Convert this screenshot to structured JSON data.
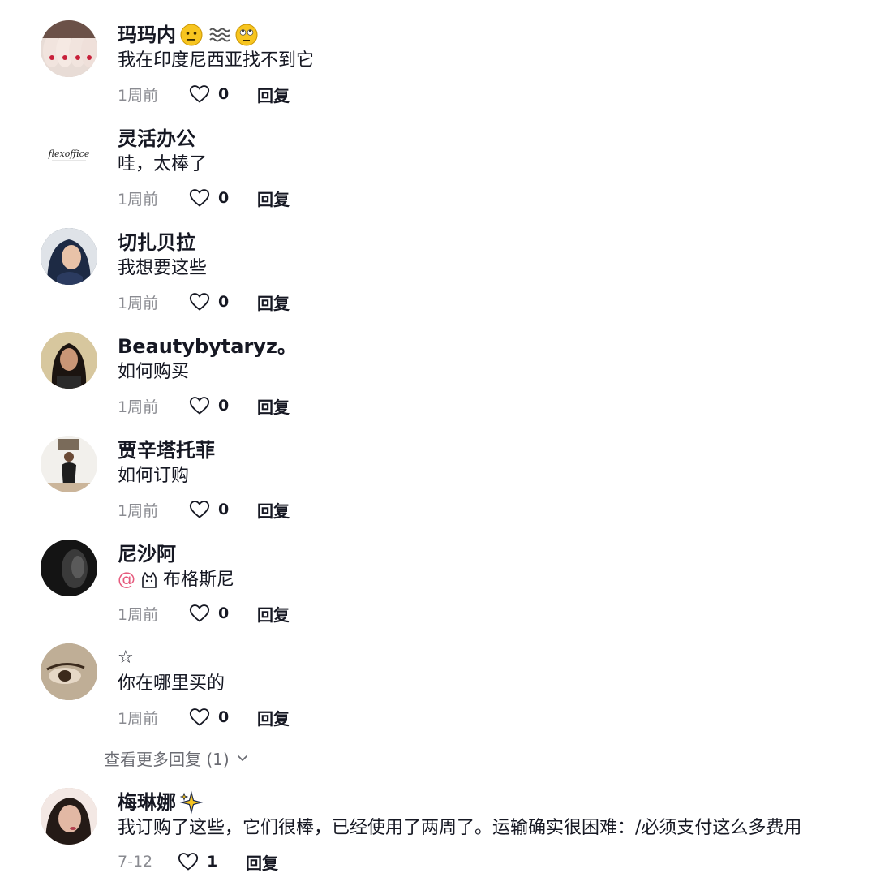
{
  "comments": [
    {
      "name": "玛玛内",
      "text": "我在印度尼西亚找不到它",
      "time": "1周前",
      "likes": "0",
      "reply": "回复",
      "name_icons": [
        "neutral-face-emoji-icon",
        "fog-emoji-icon",
        "eye-roll-emoji-icon"
      ]
    },
    {
      "name": "灵活办公",
      "text": "哇，太棒了",
      "time": "1周前",
      "likes": "0",
      "reply": "回复",
      "avatar_logo": "flexoffice"
    },
    {
      "name": "切扎贝拉",
      "text": "我想要这些",
      "time": "1周前",
      "likes": "0",
      "reply": "回复"
    },
    {
      "name": "Beautybytaryz。",
      "text": "如何购买",
      "time": "1周前",
      "likes": "0",
      "reply": "回复"
    },
    {
      "name": "贾辛塔托菲",
      "text": "如何订购",
      "time": "1周前",
      "likes": "0",
      "reply": "回复"
    },
    {
      "name": "尼沙阿",
      "mention_at": "@",
      "mention_name": "布格斯尼",
      "time": "1周前",
      "likes": "0",
      "reply": "回复"
    },
    {
      "name": "☆",
      "text": "你在哪里买的",
      "time": "1周前",
      "likes": "0",
      "reply": "回复"
    },
    {
      "name": "梅琳娜",
      "text": "我订购了这些，它们很棒，已经使用了两周了。运输确实很困难：/必须支付这么多费用",
      "time": "7-12",
      "likes": "1",
      "reply": "回复",
      "name_icons": [
        "sparkles-emoji-icon"
      ]
    }
  ],
  "more_replies": {
    "label": "查看更多回复 (1)",
    "icon": "chevron-down-icon"
  },
  "colors": {
    "mention": "#e65b7e",
    "meta": "#8a8b91",
    "text": "#161823",
    "heart_outline": "#161823"
  }
}
